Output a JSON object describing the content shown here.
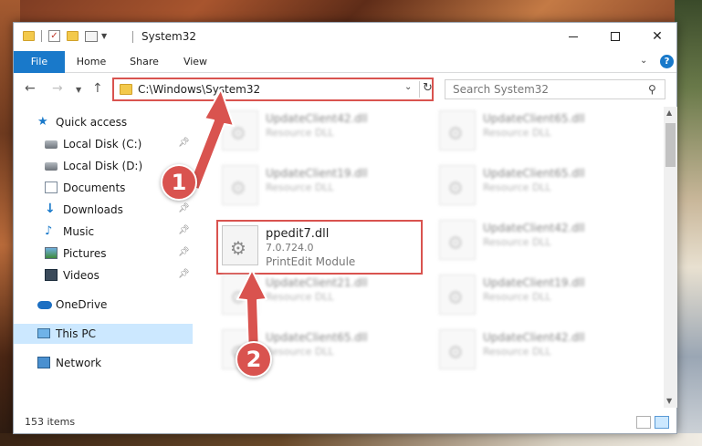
{
  "window": {
    "title": "System32",
    "minimize_glyph": "",
    "close_glyph": "✕"
  },
  "ribbon": {
    "tabs": [
      {
        "label": "File"
      },
      {
        "label": "Home"
      },
      {
        "label": "Share"
      },
      {
        "label": "View"
      }
    ]
  },
  "address": {
    "path": "C:\\Windows\\System32"
  },
  "search": {
    "placeholder": "Search System32"
  },
  "sidebar": {
    "items": [
      {
        "label": "Quick access",
        "icon": "star-icon",
        "pinned": false
      },
      {
        "label": "Local Disk (C:)",
        "icon": "disk-icon",
        "pinned": true
      },
      {
        "label": "Local Disk (D:)",
        "icon": "disk-icon",
        "pinned": false
      },
      {
        "label": "Documents",
        "icon": "documents-icon",
        "pinned": true
      },
      {
        "label": "Downloads",
        "icon": "downloads-icon",
        "pinned": true
      },
      {
        "label": "Music",
        "icon": "music-icon",
        "pinned": true
      },
      {
        "label": "Pictures",
        "icon": "pictures-icon",
        "pinned": true
      },
      {
        "label": "Videos",
        "icon": "videos-icon",
        "pinned": true
      },
      {
        "label": "OneDrive",
        "icon": "cloud-icon",
        "pinned": false
      },
      {
        "label": "This PC",
        "icon": "pc-icon",
        "pinned": false,
        "selected": true
      },
      {
        "label": "Network",
        "icon": "network-icon",
        "pinned": false
      }
    ]
  },
  "files": {
    "highlighted": {
      "name": "ppedit7.dll",
      "version": "7.0.724.0",
      "description": "PrintEdit Module"
    },
    "blurred": [
      {
        "name": "UpdateClient42.dll",
        "desc": "Resource DLL"
      },
      {
        "name": "UpdateClient65.dll",
        "desc": "Resource DLL"
      },
      {
        "name": "UpdateClient19.dll",
        "desc": "Resource DLL"
      },
      {
        "name": "UpdateClient65.dll",
        "desc": "Resource DLL"
      },
      {
        "name": "UpdateClient42.dll",
        "desc": "Resource DLL"
      },
      {
        "name": "UpdateClient21.dll",
        "desc": "Resource DLL"
      },
      {
        "name": "UpdateClient19.dll",
        "desc": "Resource DLL"
      },
      {
        "name": "UpdateClient65.dll",
        "desc": "Resource DLL"
      },
      {
        "name": "UpdateClient42.dll",
        "desc": "Resource DLL"
      }
    ]
  },
  "status": {
    "item_count": "153 items"
  },
  "annotations": {
    "step1": "1",
    "step2": "2"
  },
  "colors": {
    "accent": "#1979ca",
    "annotation_red": "#d9534f",
    "selected_bg": "#cce8ff"
  }
}
